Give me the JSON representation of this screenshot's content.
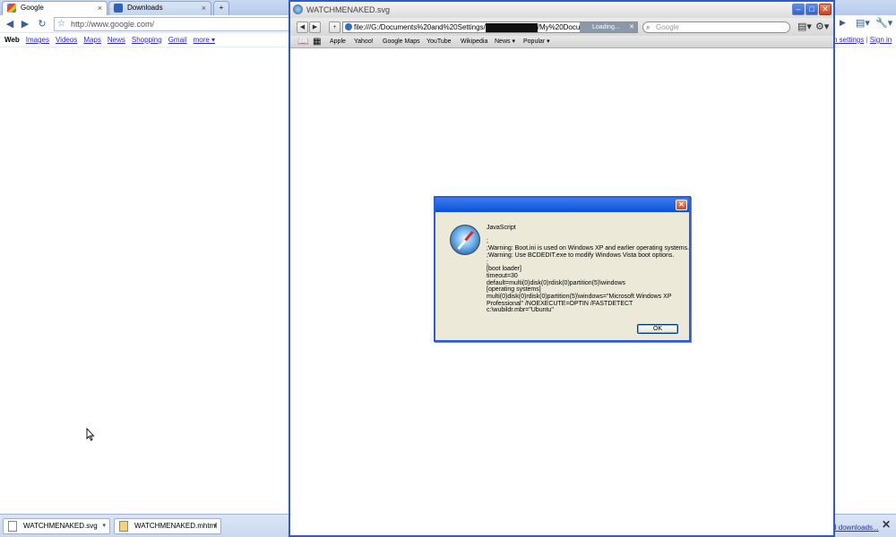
{
  "chrome": {
    "tabs": [
      {
        "label": "Google",
        "active": true
      },
      {
        "label": "Downloads",
        "active": false
      }
    ],
    "omnibox_value": "http://www.google.com/",
    "nav": {
      "web": "Web",
      "links": [
        "Images",
        "Videos",
        "Maps",
        "News",
        "Shopping",
        "Gmail",
        "more ▾"
      ]
    },
    "right_links": {
      "settings": "h settings",
      "separator": "|",
      "signin": "Sign in"
    }
  },
  "shelf": {
    "downloads": [
      "WATCHMENAKED.svg",
      "WATCHMENAKED.mhtml"
    ],
    "show_all": "ll downloads...",
    "close": "✕"
  },
  "safari": {
    "title": "WATCHMENAKED.svg",
    "url_prefix": "file:///G:/Documents%20and%20Settings/",
    "url_suffix": "/My%20Docum",
    "loading_label": "Loading...",
    "search_placeholder": "Google",
    "bookmarks": [
      "Apple",
      "Yahoo!",
      "Google Maps",
      "YouTube",
      "Wikipedia",
      "News ▾",
      "Popular ▾"
    ]
  },
  "dialog": {
    "heading": "JavaScript",
    "message": ";\n;Warning: Boot.ini is used on Windows XP and earlier operating systems.\n;Warning: Use BCDEDIT.exe to modify Windows Vista boot options.\n;\n[boot loader]\ntimeout=30\ndefault=multi(0)disk(0)rdisk(0)partition(5)\\windows\n[operating systems]\nmulti(0)disk(0)rdisk(0)partition(5)\\windows=\"Microsoft Windows XP\nProfessional\" /NOEXECUTE=OPTIN /FASTDETECT\nc:\\wubildr.mbr=\"Ubuntu\"",
    "ok_label": "OK"
  }
}
